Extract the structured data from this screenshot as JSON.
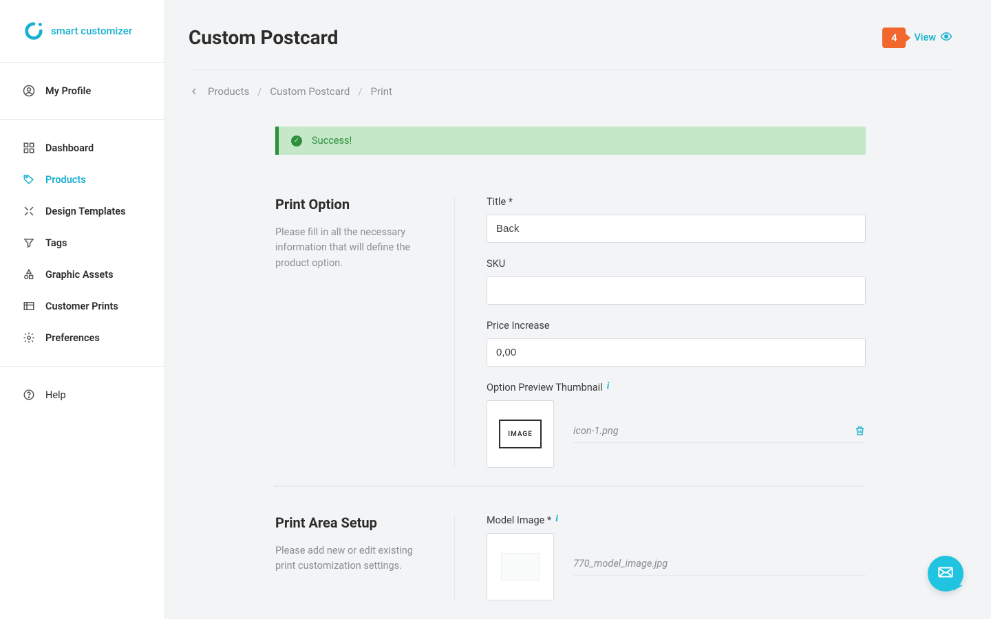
{
  "brand": "smart customizer",
  "sidebar": {
    "profile": "My Profile",
    "items": [
      {
        "label": "Dashboard"
      },
      {
        "label": "Products"
      },
      {
        "label": "Design Templates"
      },
      {
        "label": "Tags"
      },
      {
        "label": "Graphic Assets"
      },
      {
        "label": "Customer Prints"
      },
      {
        "label": "Preferences"
      }
    ],
    "help": "Help"
  },
  "header": {
    "title": "Custom Postcard",
    "badge": "4",
    "view_label": "View"
  },
  "breadcrumb": {
    "items": [
      "Products",
      "Custom Postcard",
      "Print"
    ]
  },
  "alert": {
    "text": "Success!"
  },
  "print_option": {
    "heading": "Print Option",
    "desc": "Please fill in all the necessary information that will define the product option.",
    "title_label": "Title *",
    "title_value": "Back",
    "sku_label": "SKU",
    "sku_value": "",
    "price_label": "Price Increase",
    "price_value": "0,00",
    "thumb_label": "Option Preview Thumbnail",
    "thumb_word": "IMAGE",
    "thumb_filename": "icon-1.png"
  },
  "print_area": {
    "heading": "Print Area Setup",
    "desc": "Please add new or edit existing print customization settings.",
    "model_label": "Model Image *",
    "model_filename": "770_model_image.jpg"
  }
}
